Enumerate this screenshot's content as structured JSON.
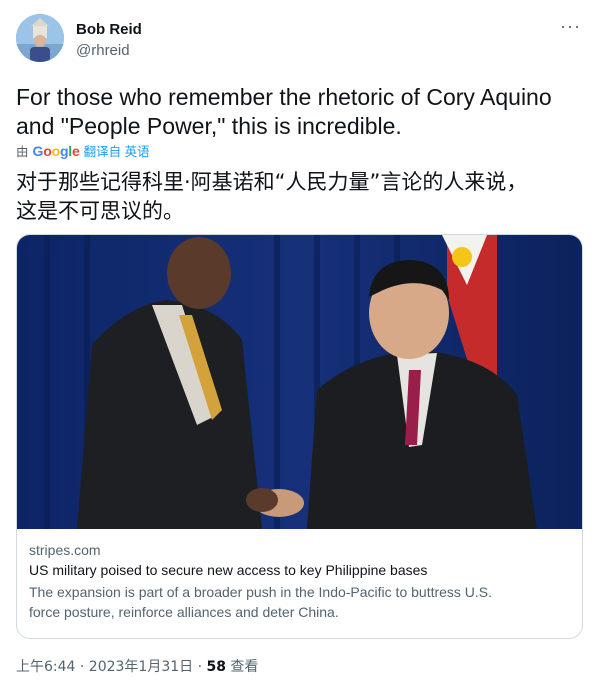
{
  "author": {
    "name": "Bob Reid",
    "handle": "@rhreid"
  },
  "more_label": "···",
  "tweet": {
    "text_line1": "For those who remember the rhetoric of Cory Aquino",
    "text_line2": "and \"People Power,\" this is incredible.",
    "translation_prefix": "由",
    "translation_provider": "Google",
    "translation_suffix": "翻译自 英语",
    "translated_line1": "对于那些记得科里·阿基诺和“人民力量”言论的人来说，",
    "translated_line2": "这是不可思议的。"
  },
  "card": {
    "domain": "stripes.com",
    "title": "US military poised to secure new access to key Philippine bases",
    "description_line1": "The expansion is part of a broader push in the Indo-Pacific to buttress U.S.",
    "description_line2": "force posture, reinforce alliances and deter China."
  },
  "meta": {
    "time_date": "上午6:44 · 2023年1月31日 · ",
    "views_count": "58",
    "views_label": " 查看"
  },
  "colors": {
    "link": "#1d9bf0",
    "secondary_text": "#536471",
    "border": "#cfd9de"
  }
}
